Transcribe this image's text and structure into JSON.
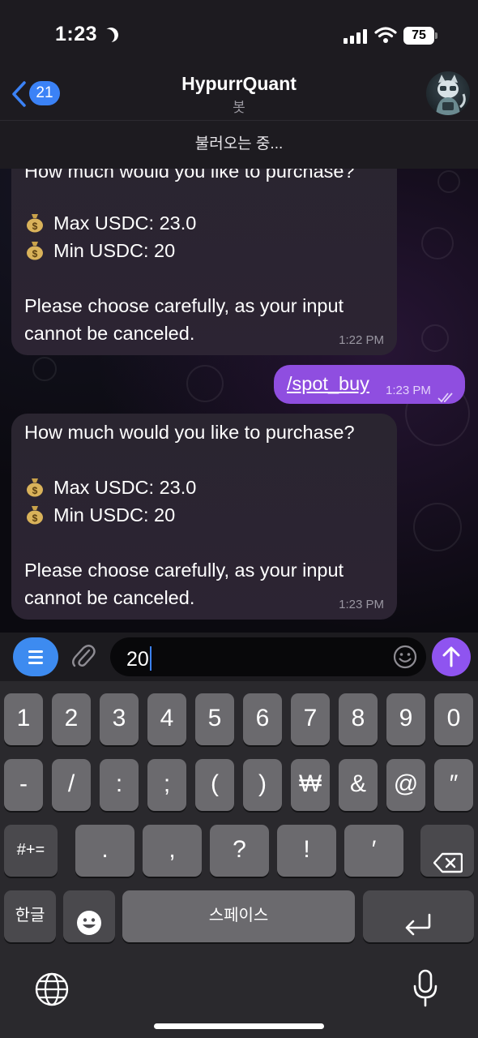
{
  "status_bar": {
    "time": "1:23",
    "battery": "75"
  },
  "header": {
    "back_count": "21",
    "title": "HypurrQuant",
    "subtitle": "봇",
    "loading_text": "불러오는 중..."
  },
  "messages": [
    {
      "direction": "incoming",
      "partial_first_line": "How much would you like to purchase?",
      "lines": [
        "Max USDC: 23.0",
        "Min USDC: 20"
      ],
      "note": [
        "Please choose carefully, as your input",
        "cannot be canceled."
      ],
      "time": "1:22 PM"
    },
    {
      "direction": "outgoing",
      "text": "/spot_buy",
      "time": "1:23 PM",
      "status": "read"
    },
    {
      "direction": "incoming",
      "first_line": "How much would you like to purchase?",
      "lines": [
        "Max USDC: 23.0",
        "Min USDC: 20"
      ],
      "note": [
        "Please choose carefully, as your input",
        "cannot be canceled."
      ],
      "time": "1:23 PM"
    }
  ],
  "composer": {
    "input_value": "20"
  },
  "keyboard": {
    "row1": [
      "1",
      "2",
      "3",
      "4",
      "5",
      "6",
      "7",
      "8",
      "9",
      "0"
    ],
    "row2": [
      "-",
      "/",
      ":",
      ";",
      "(",
      ")",
      "₩",
      "&",
      "@",
      "″"
    ],
    "row3_mode": "#+=",
    "row3": [
      ".",
      ",",
      "?",
      "!",
      "′"
    ],
    "lang_key": "한글",
    "space_label": "스페이스"
  },
  "colors": {
    "outgoing_bubble": "#8f4ee0",
    "send_button": "#8f54f0",
    "menu_button": "#3d8bf0",
    "badge": "#3b82f6"
  },
  "icons": [
    "moon-icon",
    "cellular-signal-icon",
    "wifi-icon",
    "back-chevron-icon",
    "money-bag-icon",
    "read-checks-icon",
    "menu-icon",
    "paperclip-icon",
    "emoji-icon",
    "send-arrow-icon",
    "backspace-icon",
    "emoji-keyboard-icon",
    "return-icon",
    "globe-icon",
    "microphone-icon"
  ]
}
